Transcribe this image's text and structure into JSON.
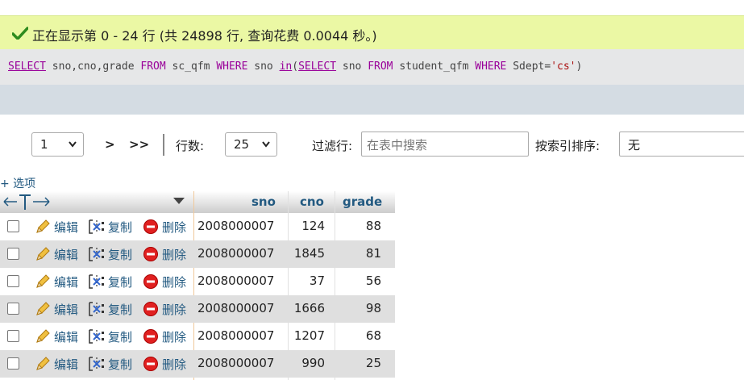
{
  "banner": {
    "message": "正在显示第 0 - 24 行 (共 24898 行, 查询花费 0.0044 秒。)"
  },
  "sql": {
    "parts": [
      "SELECT",
      " sno,cno,grade ",
      "FROM",
      " sc_qfm ",
      "WHERE",
      " sno ",
      "in",
      "(",
      "SELECT",
      " sno ",
      "FROM",
      " student_qfm ",
      "WHERE",
      " Sdept=",
      "'cs'",
      ")"
    ]
  },
  "nav": {
    "page_value": "1",
    "next": ">",
    "last": ">>",
    "rows_label": "行数:",
    "rows_value": "25",
    "filter_label": "过滤行:",
    "filter_placeholder": "在表中搜索",
    "sort_label": "按索引排序:",
    "sort_value": "无"
  },
  "options_link": "+ 选项",
  "table": {
    "columns": [
      "sno",
      "cno",
      "grade"
    ],
    "actions": {
      "edit": "编辑",
      "copy": "复制",
      "delete": "删除"
    },
    "rows": [
      {
        "sno": "2008000007",
        "cno": "124",
        "grade": "88"
      },
      {
        "sno": "2008000007",
        "cno": "1845",
        "grade": "81"
      },
      {
        "sno": "2008000007",
        "cno": "37",
        "grade": "56"
      },
      {
        "sno": "2008000007",
        "cno": "1666",
        "grade": "98"
      },
      {
        "sno": "2008000007",
        "cno": "1207",
        "grade": "68"
      },
      {
        "sno": "2008000007",
        "cno": "990",
        "grade": "25"
      }
    ]
  },
  "colors": {
    "banner_bg": "#ebf8a4",
    "keyword": "#990099",
    "link": "#235a81",
    "row_alt": "#dfdfdf"
  }
}
